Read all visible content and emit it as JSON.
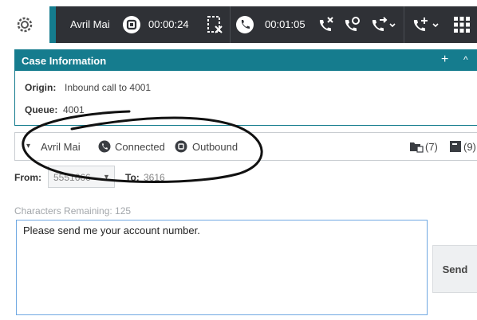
{
  "toolbar": {
    "agent_name": "Avril Mai",
    "agent_timer": "00:00:24",
    "call_timer": "00:01:05"
  },
  "case_info": {
    "title": "Case Information",
    "plus_symbol": "+",
    "caret_symbol": "^",
    "origin_label": "Origin:",
    "origin_value": "Inbound call to 4001",
    "queue_label": "Queue:",
    "queue_value": "4001"
  },
  "interaction": {
    "caret_symbol": "▾",
    "party_name": "Avril Mai",
    "status": "Connected",
    "direction": "Outbound",
    "count_a": "(7)",
    "count_b": "(9)"
  },
  "sms": {
    "from_label": "From:",
    "from_value": "5551666",
    "caret_symbol": "▼",
    "to_label": "To:",
    "to_value": "3616",
    "chars_remaining": "Characters Remaining: 125",
    "message": "Please send me your account number.",
    "send_label": "Send"
  },
  "colors": {
    "accent_teal": "#157c8e",
    "toolbar_dark": "#2f3136"
  }
}
